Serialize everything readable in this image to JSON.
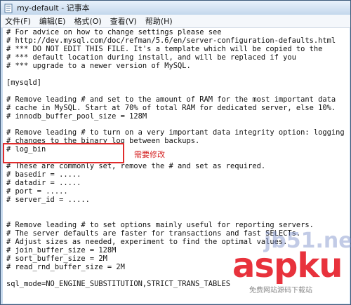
{
  "window": {
    "title": "my-default - 记事本"
  },
  "menu": [
    "文件(F)",
    "编辑(E)",
    "格式(O)",
    "查看(V)",
    "帮助(H)"
  ],
  "lines": [
    "# For advice on how to change settings please see",
    "# http://dev.mysql.com/doc/refman/5.6/en/server-configuration-defaults.html",
    "# *** DO NOT EDIT THIS FILE. It's a template which will be copied to the",
    "# *** default location during install, and will be replaced if you",
    "# *** upgrade to a newer version of MySQL.",
    "",
    "[mysqld]",
    "",
    "# Remove leading # and set to the amount of RAM for the most important data",
    "# cache in MySQL. Start at 70% of total RAM for dedicated server, else 10%.",
    "# innodb_buffer_pool_size = 128M",
    "",
    "# Remove leading # to turn on a very important data integrity option: logging",
    "# changes to the binary log between backups.",
    "# log_bin",
    "",
    "# These are commonly set, remove the # and set as required.",
    "# basedir = .....",
    "# datadir = .....",
    "# port = .....",
    "# server_id = .....",
    "",
    "",
    "# Remove leading # to set options mainly useful for reporting servers.",
    "# The server defaults are faster for transactions and fast SELECTs.",
    "# Adjust sizes as needed, experiment to find the optimal values.",
    "# join_buffer_size = 128M",
    "# sort_buffer_size = 2M",
    "# read_rnd_buffer_size = 2M",
    "",
    "sql_mode=NO_ENGINE_SUBSTITUTION,STRICT_TRANS_TABLES"
  ],
  "annotation": "需要修改",
  "watermark": {
    "jb51": "jb51.net",
    "aspku": "aspku",
    "sub": "免费网站源码下载站"
  }
}
